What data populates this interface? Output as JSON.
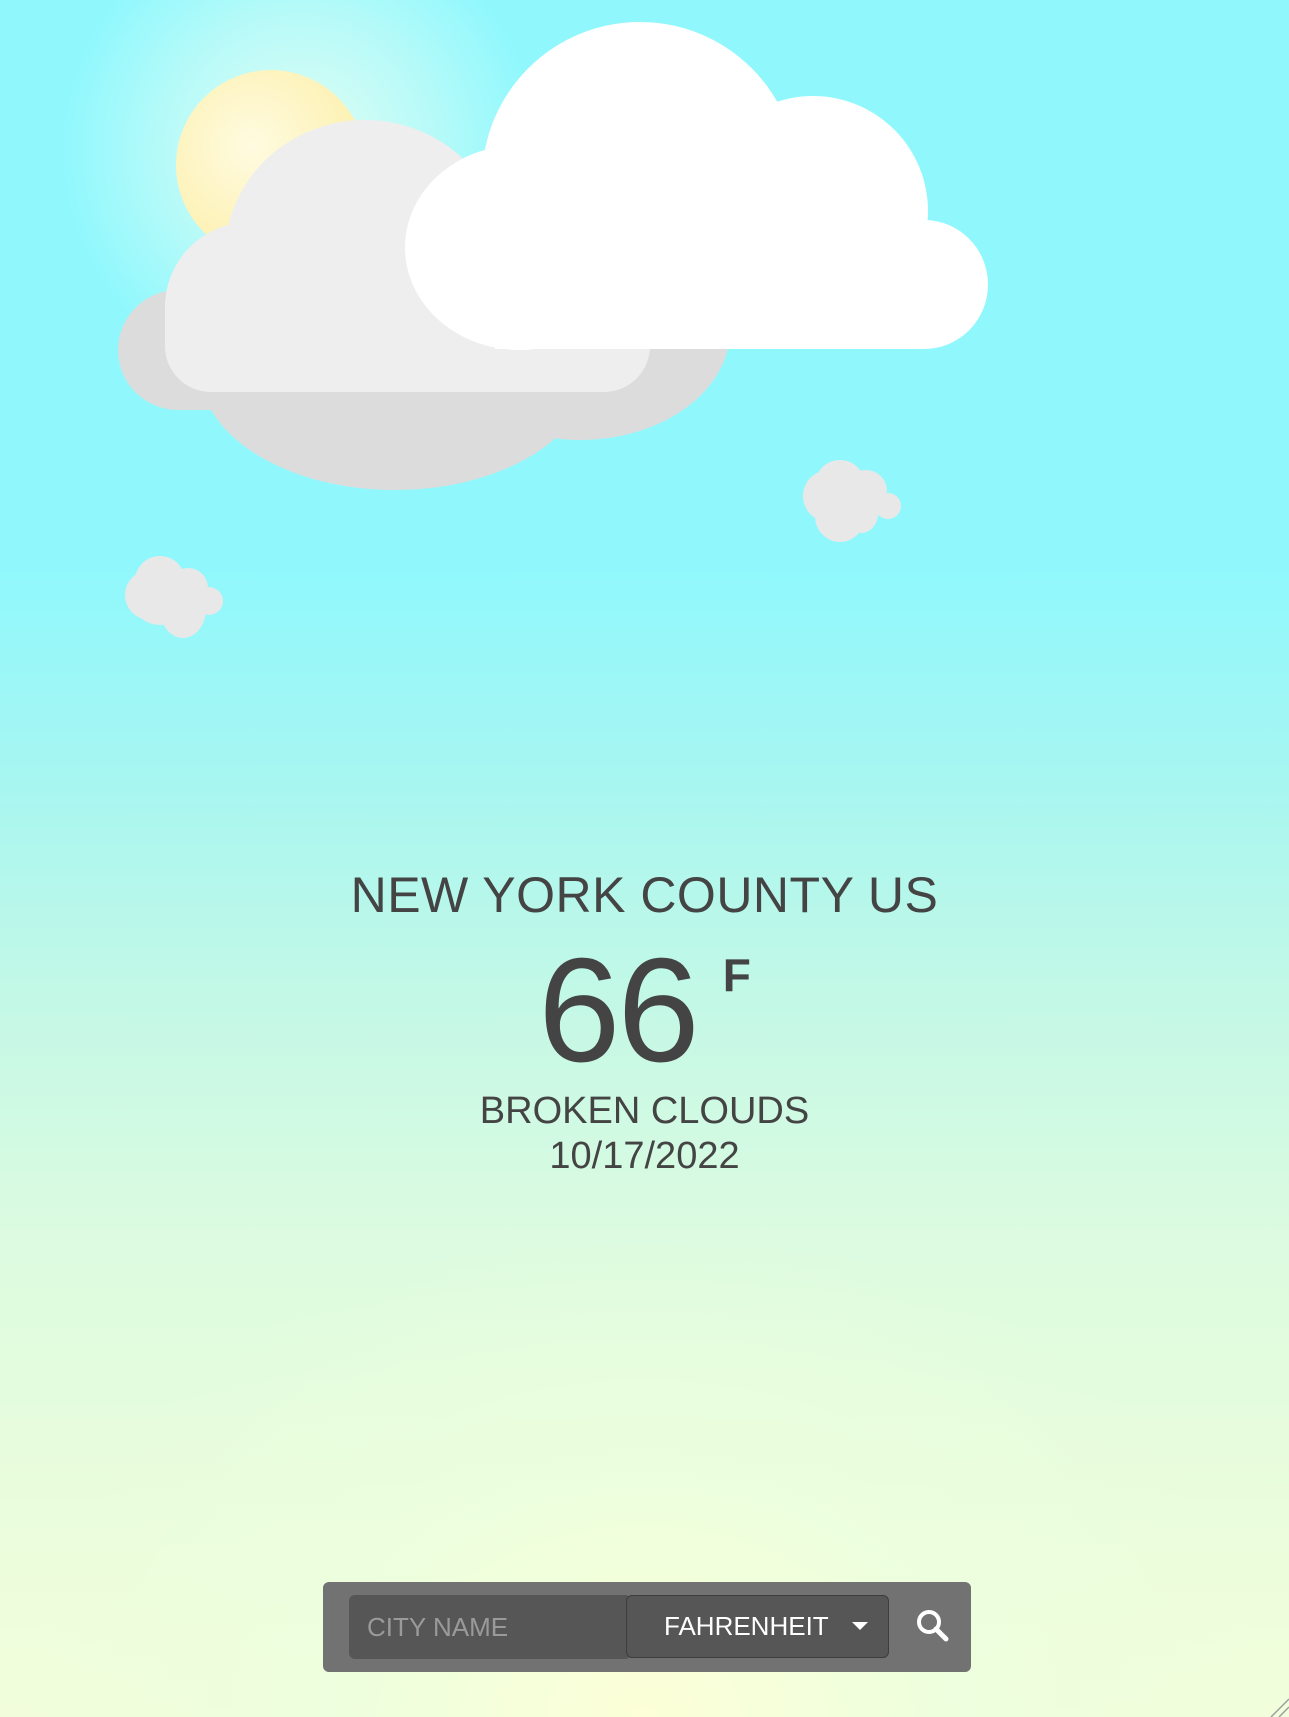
{
  "weather": {
    "location": "NEW YORK COUNTY US",
    "temperature": "66",
    "unit": "F",
    "description": "BROKEN CLOUDS",
    "date": "10/17/2022"
  },
  "search": {
    "city_placeholder": "CITY NAME",
    "city_value": "",
    "unit_selected": "FAHRENHEIT",
    "search_icon": "search-icon"
  },
  "scene": {
    "icons": [
      "sun-icon",
      "cloud-icon"
    ],
    "colors": {
      "sky_top": "#90f8fd",
      "sky_bottom": "#f2fedb",
      "text": "#444444",
      "toolbar": "#727272",
      "toolbar_field": "#565656",
      "cloud_front": "#ffffff",
      "cloud_middle": "#eeeeee",
      "cloud_back": "#dcdcdc",
      "sun": "#fdf2b8"
    }
  }
}
